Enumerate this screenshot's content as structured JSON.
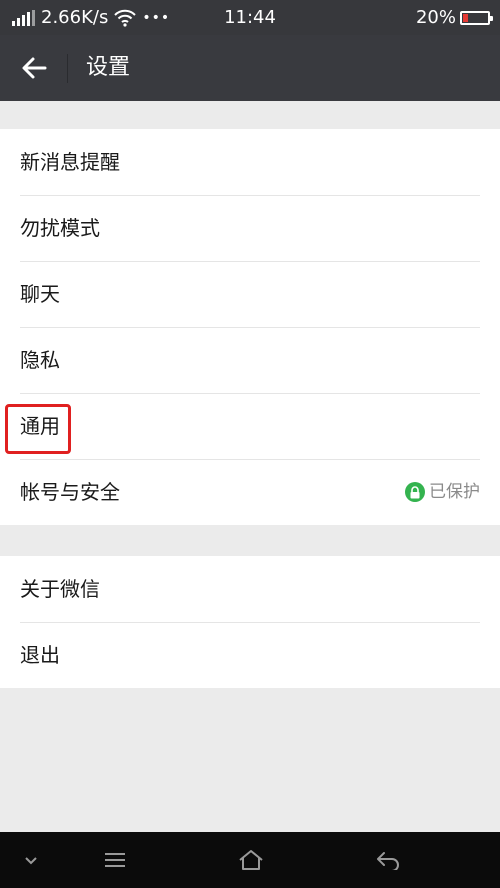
{
  "status_bar": {
    "network_speed": "2.66K/s",
    "more_dots": "•••",
    "time": "11:44",
    "battery_percent": "20%",
    "battery_level": 0.2
  },
  "header": {
    "title": "设置",
    "back_icon": "arrow-left-icon"
  },
  "settings": {
    "group1": [
      {
        "label": "新消息提醒"
      },
      {
        "label": "勿扰模式"
      },
      {
        "label": "聊天"
      },
      {
        "label": "隐私"
      },
      {
        "label": "通用"
      },
      {
        "label": "帐号与安全",
        "status": "已保护",
        "status_icon": "lock-icon"
      }
    ],
    "group2": [
      {
        "label": "关于微信"
      },
      {
        "label": "退出"
      }
    ]
  },
  "highlight_color": "#e02020",
  "nav": {
    "icons": [
      "chevron-down-icon",
      "menu-icon",
      "home-icon",
      "back-icon"
    ]
  }
}
